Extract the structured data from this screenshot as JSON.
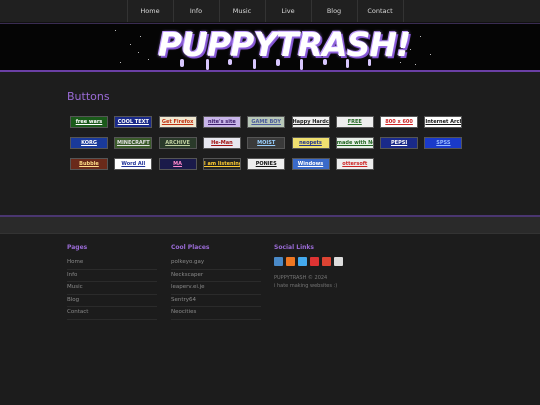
{
  "nav": {
    "items": [
      "Home",
      "Info",
      "Music",
      "Live",
      "Blog",
      "Contact"
    ]
  },
  "banner": {
    "logo_text": "PUPPYTRASH!"
  },
  "buttons_section": {
    "title": "Buttons",
    "buttons": [
      {
        "label": "free wars",
        "bg": "#1a5a1a",
        "fg": "#ffffff"
      },
      {
        "label": "COOL TEXT",
        "bg": "#1a2a8a",
        "fg": "#ffffff"
      },
      {
        "label": "Get Firefox",
        "bg": "#f0e8d0",
        "fg": "#c03010"
      },
      {
        "label": "nite's site",
        "bg": "#c9b6ea",
        "fg": "#3a1a6a"
      },
      {
        "label": "GAME BOY",
        "bg": "#b8c8b8",
        "fg": "#4a5a9a"
      },
      {
        "label": "Happy Hardcore Explorer",
        "bg": "#f0f0f0",
        "fg": "#222222"
      },
      {
        "label": "FREE",
        "bg": "#eeeeee",
        "fg": "#226622"
      },
      {
        "label": "800 x 600",
        "bg": "#ffffff",
        "fg": "#cc2222"
      },
      {
        "label": "Internet Archive",
        "bg": "#ffffff",
        "fg": "#111111"
      },
      {
        "label": "KORG",
        "bg": "#1a3a9a",
        "fg": "#ffffff"
      },
      {
        "label": "MINECRAFT",
        "bg": "#3a5a2a",
        "fg": "#e0e0e0"
      },
      {
        "label": "ARCHIVE",
        "bg": "#2a3a2a",
        "fg": "#c0d0a0"
      },
      {
        "label": "He-Man",
        "bg": "#e8e8f0",
        "fg": "#a01010"
      },
      {
        "label": "MOIST",
        "bg": "#3a3a3a",
        "fg": "#9ad0ff"
      },
      {
        "label": "neopets",
        "bg": "#f0e070",
        "fg": "#223388"
      },
      {
        "label": "made with Notepad++",
        "bg": "#e8f0e8",
        "fg": "#226622"
      },
      {
        "label": "PEPSI",
        "bg": "#1a2a8a",
        "fg": "#ffffff"
      },
      {
        "label": "SPSS",
        "bg": "#1a3aca",
        "fg": "#99bbff"
      },
      {
        "label": "Bubble",
        "bg": "#6a2a1a",
        "fg": "#ffdd88"
      },
      {
        "label": "Word All",
        "bg": "#ffffff",
        "fg": "#223399"
      },
      {
        "label": "MA",
        "bg": "#1a1a4a",
        "fg": "#ff88cc"
      },
      {
        "label": "I am listening to",
        "bg": "#222222",
        "fg": "#ffcc33"
      },
      {
        "label": "PONIES",
        "bg": "#eeeeee",
        "fg": "#111111"
      },
      {
        "label": "Windows",
        "bg": "#3a6aca",
        "fg": "#ffffff"
      },
      {
        "label": "ottersoft",
        "bg": "#eeeeee",
        "fg": "#cc2222"
      }
    ]
  },
  "footer": {
    "pages": {
      "heading": "Pages",
      "links": [
        "Home",
        "Info",
        "Music",
        "Blog",
        "Contact"
      ]
    },
    "cool_places": {
      "heading": "Cool Places",
      "links": [
        "polkeyo.gay",
        "Neckscaper",
        "leaperv.ei.je",
        "Sentry64",
        "Neocities"
      ]
    },
    "social": {
      "heading": "Social Links",
      "icons": [
        {
          "name": "photo-icon",
          "color": "#4a8ac8"
        },
        {
          "name": "soundcloud-icon",
          "color": "#ee7722"
        },
        {
          "name": "twitter-icon",
          "color": "#44aaee"
        },
        {
          "name": "youtube-icon",
          "color": "#dd3333"
        },
        {
          "name": "email-icon",
          "color": "#dd4433"
        },
        {
          "name": "misc-icon",
          "color": "#dddddd"
        }
      ],
      "copyright": "PUPPYTRASH © 2024",
      "tagline": "i hate making websites :)"
    }
  }
}
